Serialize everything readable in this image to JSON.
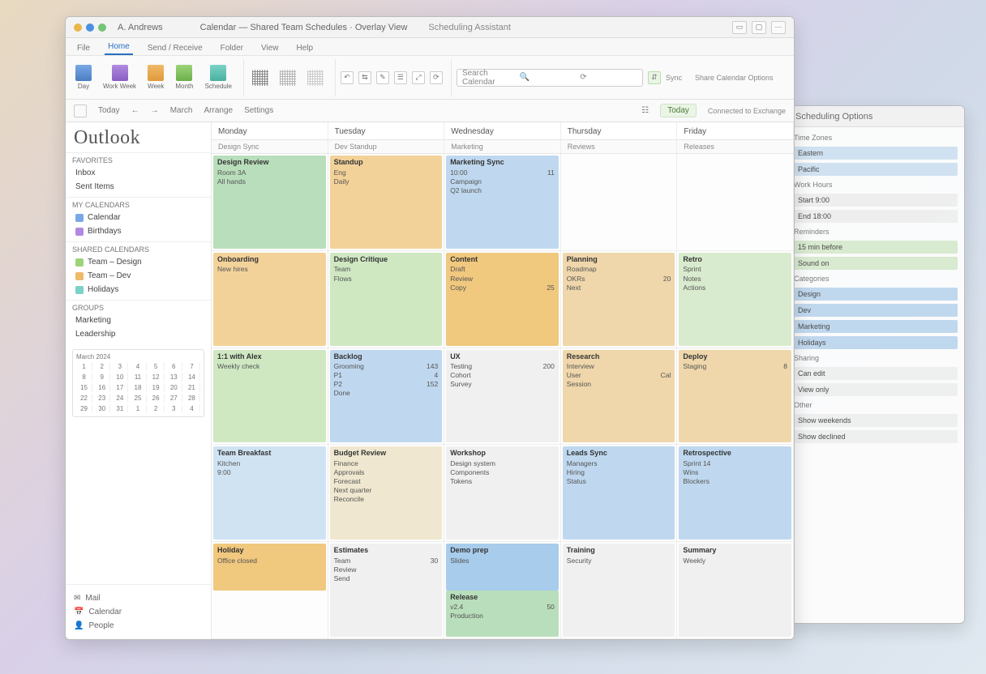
{
  "titlebar": {
    "account": "A. Andrews",
    "doc_label": "Calendar — Shared Team Schedules · Overlay View",
    "tab2": "Scheduling Assistant",
    "right_btn": "⋯"
  },
  "ribbon_tabs": [
    "File",
    "Home",
    "Send / Receive",
    "Folder",
    "View",
    "Help"
  ],
  "ribbon": {
    "group1": [
      "Day",
      "Work Week",
      "Week",
      "Month",
      "Schedule"
    ],
    "small_tools": [
      "↶",
      "⇆",
      "✎",
      "☰",
      "⤢",
      "⟳"
    ],
    "search_placeholder": "Search Calendar",
    "synclabel": "Sync",
    "sharelabel": "Share Calendar Options"
  },
  "toolbar2": {
    "items": [
      "Today",
      "←",
      "→",
      "March",
      "Arrange",
      "Settings"
    ],
    "view_btn": "Today",
    "status": "Connected to Exchange",
    "mode_icon": "☷"
  },
  "app_name": "Outlook",
  "sidebar": {
    "section1": {
      "hd": "Favorites",
      "items": [
        "Inbox",
        "Sent Items"
      ]
    },
    "section2": {
      "hd": "My Calendars",
      "items": [
        {
          "label": "Calendar",
          "color": "#7aa8e6"
        },
        {
          "label": "Birthdays",
          "color": "#b18ae0"
        }
      ]
    },
    "section3": {
      "hd": "Shared Calendars",
      "items": [
        {
          "label": "Team – Design",
          "color": "#9ed37a"
        },
        {
          "label": "Team – Dev",
          "color": "#f0b96a"
        },
        {
          "label": "Holidays",
          "color": "#7ad3c8"
        }
      ]
    },
    "section4": {
      "hd": "Groups",
      "items": [
        "Marketing",
        "Leadership"
      ]
    },
    "mini_month": "March 2024",
    "footer": [
      {
        "icon": "✉",
        "label": "Mail"
      },
      {
        "icon": "📅",
        "label": "Calendar"
      },
      {
        "icon": "👤",
        "label": "People"
      }
    ]
  },
  "columns": [
    "Monday",
    "Tuesday",
    "Wednesday",
    "Thursday",
    "Friday"
  ],
  "sub_columns": [
    "Design Sync",
    "Dev Standup",
    "Marketing",
    "Reviews",
    "Releases"
  ],
  "rows": [
    [
      {
        "c": "c-green2",
        "t": "Design Review",
        "lines": [
          [
            "Room 3A",
            ""
          ],
          [
            "All hands",
            ""
          ]
        ]
      },
      {
        "c": "c-orange1",
        "t": "Standup",
        "lines": [
          [
            "Eng",
            ""
          ],
          [
            "Daily",
            ""
          ]
        ]
      },
      {
        "c": "c-blue1",
        "t": "Marketing Sync",
        "lines": [
          [
            "10:00",
            "11"
          ],
          [
            "Campaign",
            ""
          ],
          [
            "Q2 launch",
            ""
          ]
        ]
      },
      {
        "c": "",
        "t": "",
        "lines": []
      },
      {
        "c": "",
        "t": "",
        "lines": []
      }
    ],
    [
      {
        "c": "c-orange1",
        "t": "Onboarding",
        "lines": [
          [
            "New hires",
            ""
          ]
        ],
        "pos": "full"
      },
      {
        "c": "c-green1",
        "t": "Design Critique",
        "lines": [
          [
            "Team",
            ""
          ],
          [
            "Flows",
            ""
          ]
        ]
      },
      {
        "c": "c-orange2",
        "t": "Content",
        "lines": [
          [
            "Draft",
            ""
          ],
          [
            "Review",
            ""
          ],
          [
            "Copy",
            "25"
          ]
        ]
      },
      {
        "c": "c-orange3",
        "t": "Planning",
        "lines": [
          [
            "Roadmap",
            ""
          ],
          [
            "OKRs",
            "20"
          ],
          [
            "Next",
            ""
          ]
        ]
      },
      {
        "c": "c-green3",
        "t": "Retro",
        "lines": [
          [
            "Sprint",
            ""
          ],
          [
            "Notes",
            ""
          ],
          [
            "Actions",
            ""
          ]
        ]
      }
    ],
    [
      {
        "c": "c-green1",
        "t": "1:1 with Alex",
        "lines": [
          [
            "Weekly check",
            ""
          ]
        ]
      },
      {
        "c": "c-blue1",
        "t": "Backlog",
        "lines": [
          [
            "Grooming",
            "143"
          ],
          [
            "P1",
            "4"
          ],
          [
            "P2",
            "152"
          ],
          [
            "Done",
            ""
          ]
        ]
      },
      {
        "c": "c-gray",
        "t": "UX",
        "lines": [
          [
            "Testing",
            "200"
          ],
          [
            "Cohort",
            ""
          ],
          [
            "Survey",
            ""
          ]
        ]
      },
      {
        "c": "c-orange3",
        "t": "Research",
        "lines": [
          [
            "Interview",
            ""
          ],
          [
            "User",
            "Cal"
          ],
          [
            "Session",
            ""
          ]
        ]
      },
      {
        "c": "c-orange3",
        "t": "Deploy",
        "lines": [
          [
            "Staging",
            "8"
          ],
          [
            "",
            ""
          ]
        ]
      }
    ],
    [
      {
        "c": "c-blue3",
        "t": "Team Breakfast",
        "lines": [
          [
            "Kitchen",
            ""
          ],
          [
            "9:00",
            ""
          ]
        ]
      },
      {
        "c": "c-beige",
        "t": "Budget Review",
        "lines": [
          [
            "Finance",
            ""
          ],
          [
            "Approvals",
            ""
          ],
          [
            "Forecast",
            ""
          ],
          [
            "Next quarter",
            ""
          ],
          [
            "Reconcile",
            ""
          ]
        ]
      },
      {
        "c": "c-gray",
        "t": "Workshop",
        "lines": [
          [
            "Design system",
            ""
          ],
          [
            "Components",
            ""
          ],
          [
            "Tokens",
            ""
          ]
        ]
      },
      {
        "c": "c-blue1",
        "t": "Leads Sync",
        "lines": [
          [
            "Managers",
            ""
          ],
          [
            "Hiring",
            ""
          ],
          [
            "Status",
            ""
          ]
        ]
      },
      {
        "c": "c-blue1",
        "t": "Retrospective",
        "lines": [
          [
            "Sprint 14",
            ""
          ],
          [
            "Wins",
            ""
          ],
          [
            "Blockers",
            ""
          ]
        ]
      }
    ],
    [
      {
        "c": "c-orange2",
        "t": "Holiday",
        "lines": [
          [
            "Office closed",
            ""
          ]
        ],
        "pos": "half-top"
      },
      {
        "c": "c-gray",
        "t": "Estimates",
        "lines": [
          [
            "Team",
            "30"
          ],
          [
            "Review",
            ""
          ],
          [
            "Send",
            ""
          ]
        ]
      },
      {
        "c": "c-green2",
        "t": "Release",
        "lines": [
          [
            "v2.4",
            "50"
          ],
          [
            "Production",
            ""
          ]
        ],
        "pos": "half-bot",
        "second": {
          "c": "c-blue2",
          "t": "Demo prep",
          "lines": [
            [
              "Slides",
              ""
            ]
          ],
          "pos": "half-top"
        }
      },
      {
        "c": "c-gray",
        "t": "Training",
        "lines": [
          [
            "Security",
            ""
          ]
        ]
      },
      {
        "c": "c-gray",
        "t": "Summary",
        "lines": [
          [
            "Weekly",
            ""
          ]
        ]
      }
    ]
  ],
  "back_panel": {
    "title": "Scheduling Options",
    "sections": [
      {
        "hd": "Time Zones",
        "items": [
          "Eastern",
          "Pacific"
        ]
      },
      {
        "hd": "Work Hours",
        "items": [
          "Start 9:00",
          "End 18:00"
        ]
      },
      {
        "hd": "Reminders",
        "items": [
          "15 min before",
          "Sound on"
        ]
      },
      {
        "hd": "Categories",
        "items": [
          "Design",
          "Dev",
          "Marketing",
          "Holidays"
        ]
      },
      {
        "hd": "Sharing",
        "items": [
          "Can edit",
          "View only"
        ]
      },
      {
        "hd": "Other",
        "items": [
          "Show weekends",
          "Show declined"
        ]
      }
    ]
  }
}
